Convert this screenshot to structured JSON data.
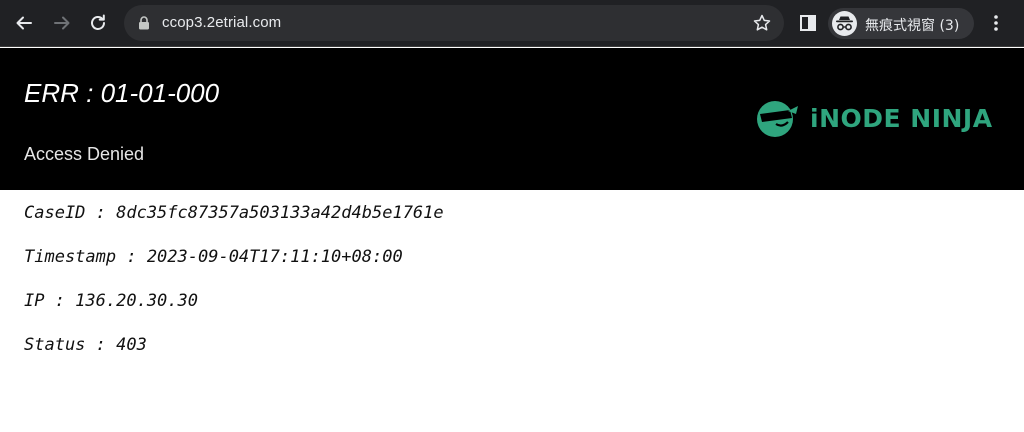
{
  "browser": {
    "url": "ccop3.2etrial.com",
    "incognito_label": "無痕式視窗 (3)",
    "icons": {
      "back": "arrow-left-icon",
      "forward": "arrow-right-icon",
      "reload": "reload-icon",
      "lock": "lock-icon",
      "bookmark": "star-icon",
      "side_panel": "side-panel-icon",
      "incognito": "incognito-icon",
      "menu": "kebab-menu-icon"
    }
  },
  "header": {
    "error_code": "ERR : 01-01-000",
    "message": "Access Denied",
    "logo_text": "iNODE NINJA",
    "logo_color": "#2fa57e",
    "background": "#000000"
  },
  "details": {
    "case_id": "CaseID : 8dc35fc87357a503133a42d4b5e1761e",
    "timestamp": "Timestamp : 2023-09-04T17:11:10+08:00",
    "ip": "IP : 136.20.30.30",
    "status": "Status : 403"
  }
}
